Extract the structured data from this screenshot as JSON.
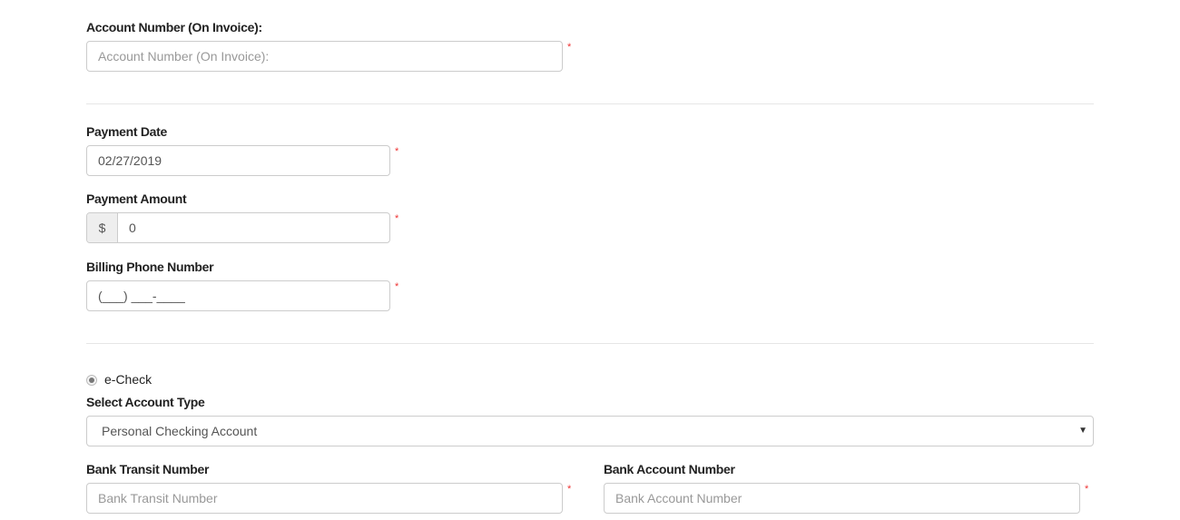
{
  "account": {
    "label": "Account Number (On Invoice):",
    "placeholder": "Account Number (On Invoice):"
  },
  "payment_date": {
    "label": "Payment Date",
    "value": "02/27/2019"
  },
  "payment_amount": {
    "label": "Payment Amount",
    "prefix": "$",
    "value": "0"
  },
  "phone": {
    "label": "Billing Phone Number",
    "value": "(___) ___-____"
  },
  "required_marker": "*",
  "echeck": {
    "label": "e-Check",
    "selected": true
  },
  "account_type": {
    "label": "Select Account Type",
    "value": "Personal Checking Account"
  },
  "transit": {
    "label": "Bank Transit Number",
    "placeholder": "Bank Transit Number"
  },
  "bank_account": {
    "label": "Bank Account Number",
    "placeholder": "Bank Account Number"
  }
}
